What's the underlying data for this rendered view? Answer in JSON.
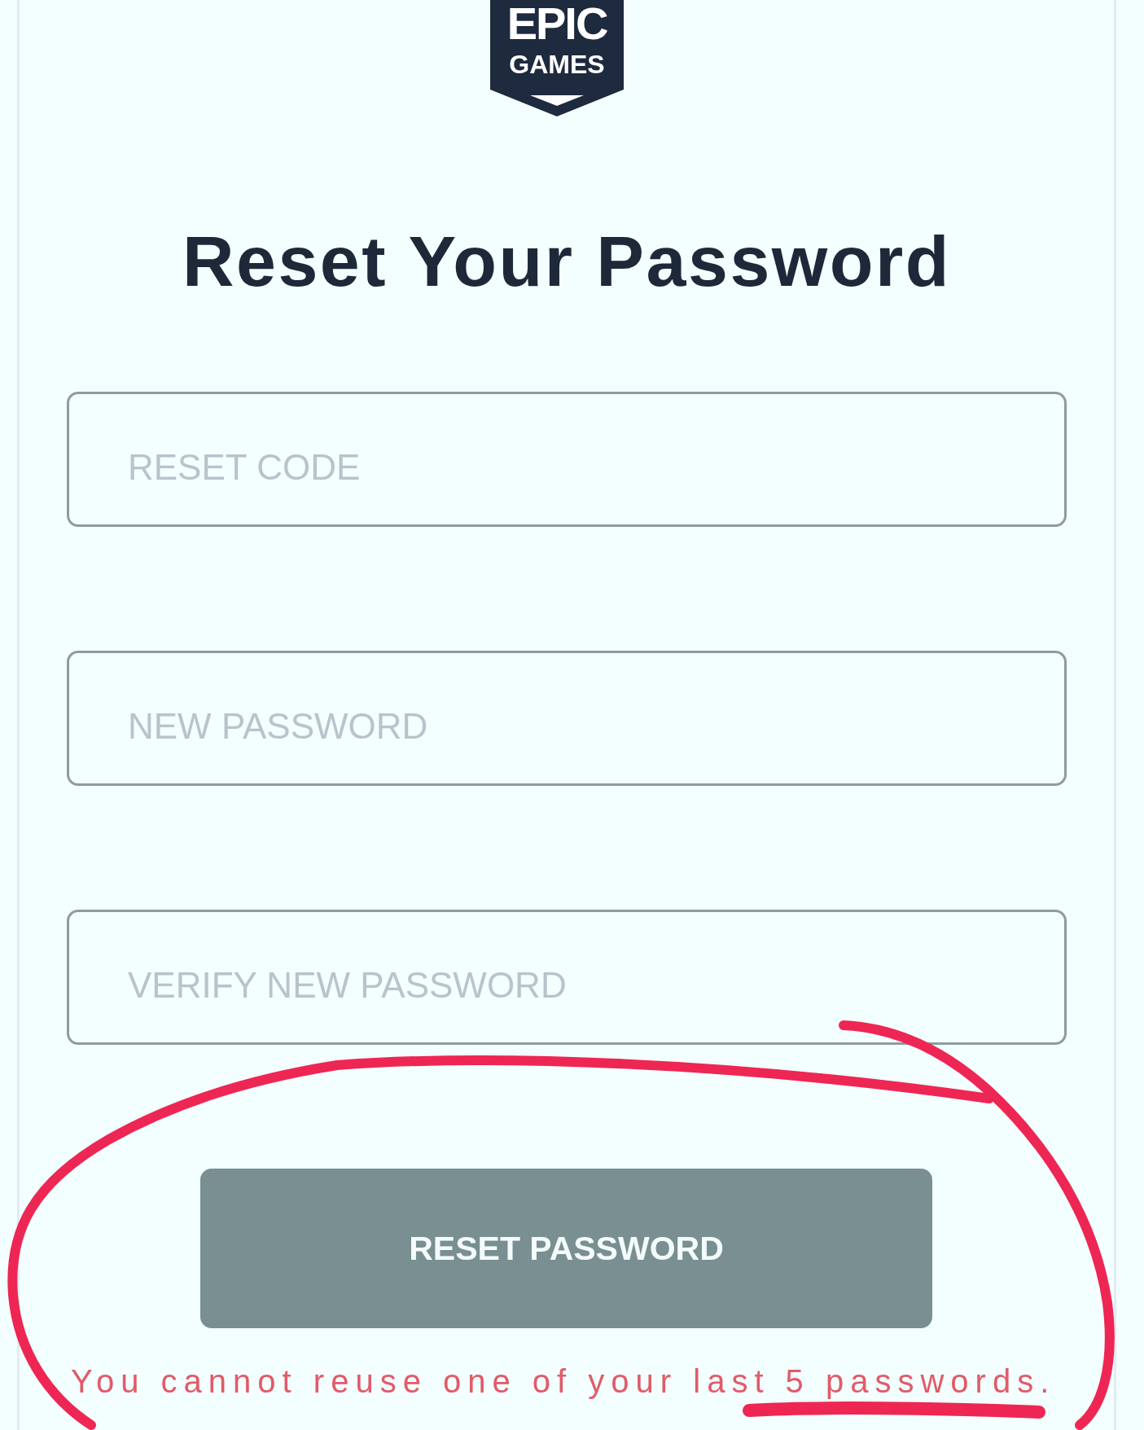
{
  "logo": {
    "wordmark_top": "EPIC",
    "wordmark_bottom": "GAMES"
  },
  "title": "Reset Your Password",
  "fields": [
    {
      "placeholder": "RESET CODE"
    },
    {
      "placeholder": "NEW PASSWORD"
    },
    {
      "placeholder": "VERIFY NEW PASSWORD"
    }
  ],
  "submit_button": {
    "label": "RESET PASSWORD",
    "disabled": true
  },
  "error_message": "You cannot reuse one of your last 5 passwords."
}
